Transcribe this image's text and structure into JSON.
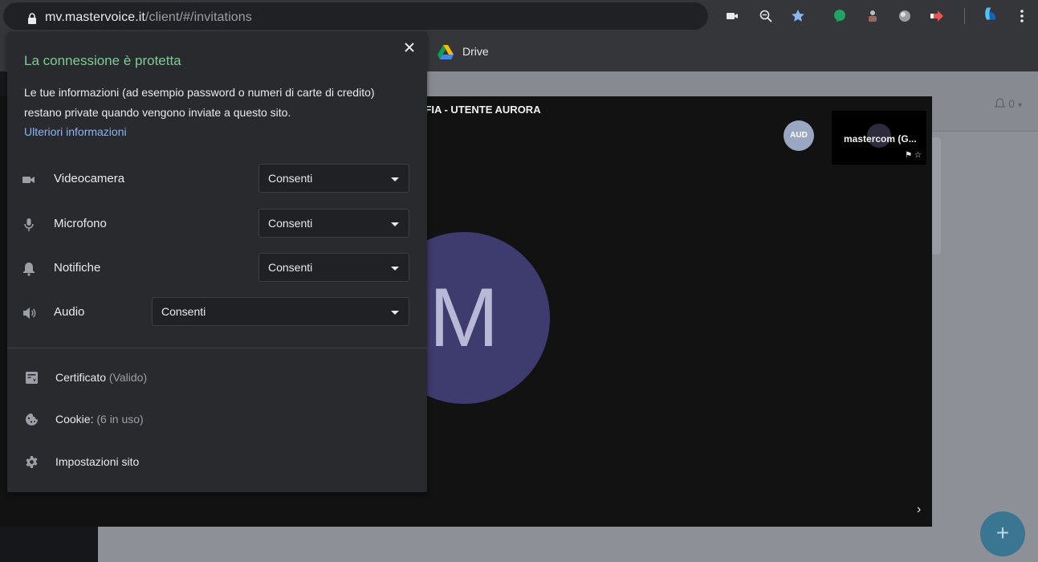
{
  "browser": {
    "url_host": "mv.mastervoice.it",
    "url_path": "/client/#/invitations",
    "bookmark_drive": "Drive"
  },
  "site_info": {
    "title": "La connessione è protetta",
    "description": "Le tue informazioni (ad esempio password o numeri di carte di credito) restano private quando vengono inviate a questo sito.",
    "learn_more": "Ulteriori informazioni",
    "permissions": [
      {
        "label": "Videocamera",
        "value": "Consenti",
        "icon": "videocam-icon"
      },
      {
        "label": "Microfono",
        "value": "Consenti",
        "icon": "microphone-icon"
      },
      {
        "label": "Notifiche",
        "value": "Consenti",
        "icon": "bell-icon"
      },
      {
        "label": "Audio",
        "value": "Consenti",
        "icon": "speaker-icon"
      }
    ],
    "certificate_label": "Certificato",
    "certificate_status": "(Valido)",
    "cookie_label": "Cookie:",
    "cookie_status": "(6 in uso)",
    "settings_label": "Impostazioni sito"
  },
  "page": {
    "notification_count": "0",
    "video_title": "AFIA - UTENTE AURORA",
    "participant_badge": "AUD",
    "thumbnail_name": "mastercom (G...",
    "main_avatar_letter": "M",
    "fab_label": "+"
  },
  "colors": {
    "secure_green": "#81c995",
    "link_blue": "#8ab4f8",
    "avatar_purple": "#3e3b6e",
    "fab_blue": "#3a7591"
  }
}
